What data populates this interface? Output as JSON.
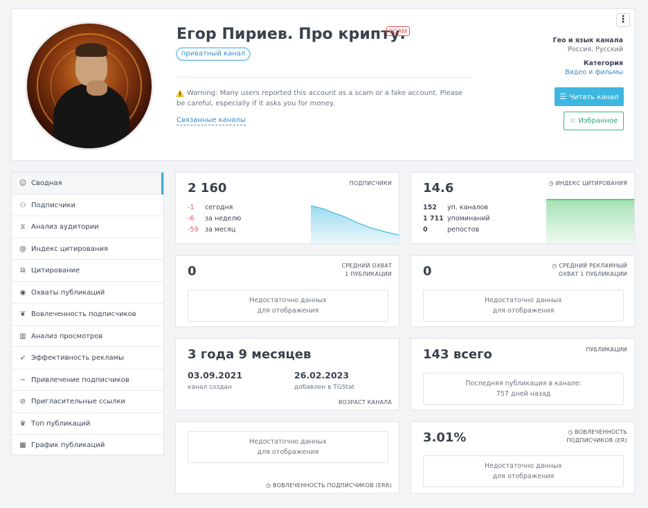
{
  "channel": {
    "title": "Егор Пириев. Про крипту.",
    "scam_badge": "SCAM",
    "private_badge": "приватный канал",
    "warning": "Warning: Many users reported this account as a scam or a fake account. Please be careful, especially if it asks you for money.",
    "linked_channels": "Связанные каналы",
    "geo_label": "Гео и язык канала",
    "geo_value": "Россия, Русский",
    "category_label": "Категория",
    "category_value": "Видео и фильмы",
    "read_button": "Читать канал",
    "fav_button": "Избранное",
    "menu_icon": "⋮"
  },
  "sidebar": {
    "items": [
      {
        "label": "Сводная",
        "icon": "☺"
      },
      {
        "label": "Подписчики",
        "icon": "⚇"
      },
      {
        "label": "Анализ аудитории",
        "icon": "⧖"
      },
      {
        "label": "Индекс цитирования",
        "icon": "@"
      },
      {
        "label": "Цитирование",
        "icon": "⧉"
      },
      {
        "label": "Охваты публикаций",
        "icon": "◉"
      },
      {
        "label": "Вовлеченность подписчиков",
        "icon": "❦"
      },
      {
        "label": "Анализ просмотров",
        "icon": "▥"
      },
      {
        "label": "Эффективность рекламы",
        "icon": "➶"
      },
      {
        "label": "Привлечение подписчиков",
        "icon": "∼"
      },
      {
        "label": "Пригласительные ссылки",
        "icon": "⊘"
      },
      {
        "label": "Топ публикаций",
        "icon": "♛"
      },
      {
        "label": "График публикаций",
        "icon": "▦"
      }
    ]
  },
  "subscribers": {
    "value": "2 160",
    "label": "ПОДПИСЧИКИ",
    "rows": [
      {
        "num": "-1",
        "text": "сегодня"
      },
      {
        "num": "-6",
        "text": "за неделю"
      },
      {
        "num": "-59",
        "text": "за месяц"
      }
    ],
    "trend": [
      1.0,
      0.96,
      0.92,
      0.86,
      0.78,
      0.72,
      0.66,
      0.58,
      0.5,
      0.42,
      0.35,
      0.28,
      0.22,
      0.18,
      0.12,
      0.08,
      0.04,
      0.0
    ],
    "color": "#3db7e0"
  },
  "citation": {
    "value": "14.6",
    "label": "ИНДЕКС ЦИТИРОВАНИЯ",
    "rows": [
      {
        "num": "152",
        "text": "уп. каналов"
      },
      {
        "num": "1 711",
        "text": "упоминаний"
      },
      {
        "num": "0",
        "text": "репостов"
      }
    ],
    "color": "#3cbf5a"
  },
  "reach": {
    "value": "0",
    "label_line1": "СРЕДНИЙ ОХВАТ",
    "label_line2": "1 ПУБЛИКАЦИИ",
    "nodata_line1": "Недостаточно данных",
    "nodata_line2": "для отображения"
  },
  "ad_reach": {
    "value": "0",
    "label_line1": "СРЕДНИЙ РЕКЛАМНЫЙ",
    "label_line2": "ОХВАТ 1 ПУБЛИКАЦИИ",
    "nodata_line1": "Недостаточно данных",
    "nodata_line2": "для отображения"
  },
  "age": {
    "value": "3 года 9 месяцев",
    "created_date": "03.09.2021",
    "created_label": "канал создан",
    "added_date": "26.02.2023",
    "added_label": "добавлен в TGStat",
    "label": "ВОЗРАСТ КАНАЛА"
  },
  "posts": {
    "value": "143 всего",
    "label": "ПУБЛИКАЦИИ",
    "last_line1": "Последняя публикация в канале:",
    "last_line2": "757 дней назад"
  },
  "err": {
    "nodata_line1": "Недостаточно данных",
    "nodata_line2": "для отображения",
    "label": "ВОВЛЕЧЕННОСТЬ ПОДПИСЧИКОВ (ERR)"
  },
  "er": {
    "value": "3.01%",
    "label_line1": "ВОВЛЕЧЕННОСТЬ",
    "label_line2": "ПОДПИСЧИКОВ (ER)",
    "nodata_line1": "Недостаточно данных",
    "nodata_line2": "для отображения"
  }
}
